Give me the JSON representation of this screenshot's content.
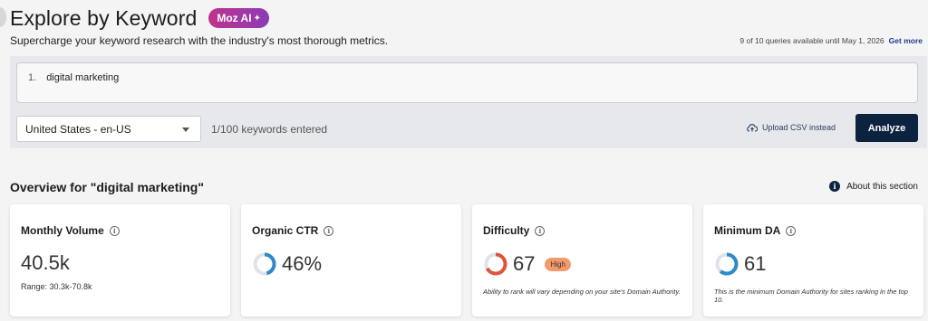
{
  "header": {
    "title": "Explore by Keyword",
    "ai_badge": "Moz AI",
    "subtitle": "Supercharge your keyword research with the industry's most thorough metrics.",
    "quota_text": "9 of 10 queries available until May 1, 2026",
    "quota_link": "Get more"
  },
  "query": {
    "line_number": "1.",
    "keyword": "digital marketing",
    "locale": "United States - en-US",
    "keyword_count": "1/100 keywords entered",
    "upload_label": "Upload CSV instead",
    "analyze_label": "Analyze"
  },
  "overview": {
    "title": "Overview for \"digital marketing\"",
    "about_label": "About this section"
  },
  "cards": {
    "volume": {
      "title": "Monthly Volume",
      "value": "40.5k",
      "range": "Range: 30.3k-70.8k"
    },
    "ctr": {
      "title": "Organic CTR",
      "value": "46%",
      "percent": 46
    },
    "difficulty": {
      "title": "Difficulty",
      "value": "67",
      "percent": 67,
      "badge": "High",
      "note": "Ability to rank will vary depending on your site's Domain Authority."
    },
    "min_da": {
      "title": "Minimum DA",
      "value": "61",
      "percent": 61,
      "note": "This is the minimum Domain Authority for sites ranking in the top 10."
    }
  },
  "colors": {
    "navy": "#0c2340",
    "donut_blue": "#2f88c9",
    "donut_red": "#e0533d",
    "donut_track": "#dfe3e8",
    "high_badge": "#f39a6b"
  }
}
